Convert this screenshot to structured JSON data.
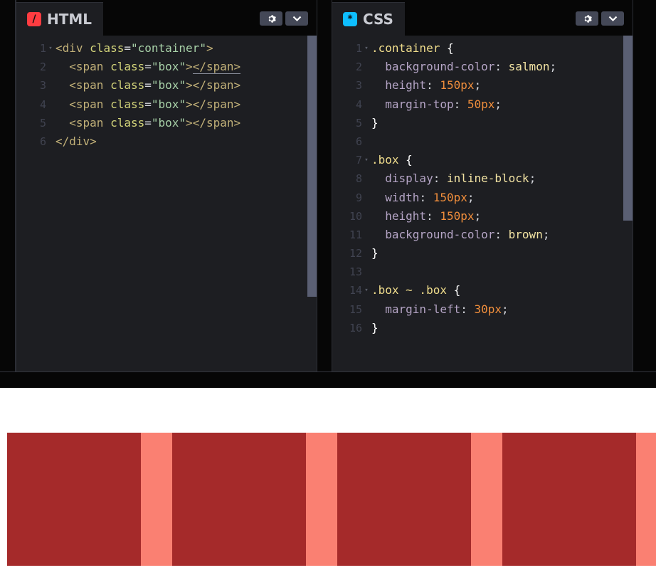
{
  "html_pane": {
    "title": "HTML",
    "icon": "html-slash-icon",
    "icon_color": "#ff3c41",
    "lines": [
      {
        "n": "1",
        "fold": true,
        "parts": [
          [
            "tag",
            "<div "
          ],
          [
            "attr",
            "class"
          ],
          [
            "punc",
            "="
          ],
          [
            "str",
            "\"container\""
          ],
          [
            "tag",
            ">"
          ]
        ]
      },
      {
        "n": "2",
        "fold": false,
        "parts": [
          [
            "punc",
            "  "
          ],
          [
            "tag",
            "<span "
          ],
          [
            "attr",
            "class"
          ],
          [
            "punc",
            "="
          ],
          [
            "str",
            "\"box\""
          ],
          [
            "tag",
            ">"
          ],
          [
            "tag-u",
            "</span>"
          ]
        ]
      },
      {
        "n": "3",
        "fold": false,
        "parts": [
          [
            "punc",
            "  "
          ],
          [
            "tag",
            "<span "
          ],
          [
            "attr",
            "class"
          ],
          [
            "punc",
            "="
          ],
          [
            "str",
            "\"box\""
          ],
          [
            "tag",
            ">"
          ],
          [
            "tag",
            "</span>"
          ]
        ]
      },
      {
        "n": "4",
        "fold": false,
        "parts": [
          [
            "punc",
            "  "
          ],
          [
            "tag",
            "<span "
          ],
          [
            "attr",
            "class"
          ],
          [
            "punc",
            "="
          ],
          [
            "str",
            "\"box\""
          ],
          [
            "tag",
            ">"
          ],
          [
            "tag",
            "</span>"
          ]
        ]
      },
      {
        "n": "5",
        "fold": false,
        "parts": [
          [
            "punc",
            "  "
          ],
          [
            "tag",
            "<span "
          ],
          [
            "attr",
            "class"
          ],
          [
            "punc",
            "="
          ],
          [
            "str",
            "\"box\""
          ],
          [
            "tag",
            ">"
          ],
          [
            "tag",
            "</span>"
          ]
        ]
      },
      {
        "n": "6",
        "fold": false,
        "parts": [
          [
            "tag",
            "</div>"
          ]
        ]
      }
    ]
  },
  "css_pane": {
    "title": "CSS",
    "icon": "css-asterisk-icon",
    "icon_color": "#0ebeff",
    "lines": [
      {
        "n": "1",
        "fold": true,
        "parts": [
          [
            "sel",
            ".container"
          ],
          [
            "brace",
            " {"
          ]
        ]
      },
      {
        "n": "2",
        "fold": false,
        "parts": [
          [
            "punc",
            "  "
          ],
          [
            "prop",
            "background-color"
          ],
          [
            "punc",
            ": "
          ],
          [
            "val",
            "salmon"
          ],
          [
            "punc",
            ";"
          ]
        ]
      },
      {
        "n": "3",
        "fold": false,
        "parts": [
          [
            "punc",
            "  "
          ],
          [
            "prop",
            "height"
          ],
          [
            "punc",
            ": "
          ],
          [
            "num",
            "150px"
          ],
          [
            "punc",
            ";"
          ]
        ]
      },
      {
        "n": "4",
        "fold": false,
        "parts": [
          [
            "punc",
            "  "
          ],
          [
            "prop",
            "margin-top"
          ],
          [
            "punc",
            ": "
          ],
          [
            "num",
            "50px"
          ],
          [
            "punc",
            ";"
          ]
        ]
      },
      {
        "n": "5",
        "fold": false,
        "parts": [
          [
            "brace",
            "}"
          ]
        ]
      },
      {
        "n": "6",
        "fold": false,
        "parts": []
      },
      {
        "n": "7",
        "fold": true,
        "parts": [
          [
            "sel",
            ".box"
          ],
          [
            "brace",
            " {"
          ]
        ]
      },
      {
        "n": "8",
        "fold": false,
        "parts": [
          [
            "punc",
            "  "
          ],
          [
            "prop",
            "display"
          ],
          [
            "punc",
            ": "
          ],
          [
            "val",
            "inline-block"
          ],
          [
            "punc",
            ";"
          ]
        ]
      },
      {
        "n": "9",
        "fold": false,
        "parts": [
          [
            "punc",
            "  "
          ],
          [
            "prop",
            "width"
          ],
          [
            "punc",
            ": "
          ],
          [
            "num",
            "150px"
          ],
          [
            "punc",
            ";"
          ]
        ]
      },
      {
        "n": "10",
        "fold": false,
        "parts": [
          [
            "punc",
            "  "
          ],
          [
            "prop",
            "height"
          ],
          [
            "punc",
            ": "
          ],
          [
            "num",
            "150px"
          ],
          [
            "punc",
            ";"
          ]
        ]
      },
      {
        "n": "11",
        "fold": false,
        "parts": [
          [
            "punc",
            "  "
          ],
          [
            "prop",
            "background-color"
          ],
          [
            "punc",
            ": "
          ],
          [
            "val",
            "brown"
          ],
          [
            "punc",
            ";"
          ]
        ]
      },
      {
        "n": "12",
        "fold": false,
        "parts": [
          [
            "brace",
            "}"
          ]
        ]
      },
      {
        "n": "13",
        "fold": false,
        "parts": []
      },
      {
        "n": "14",
        "fold": true,
        "parts": [
          [
            "sel",
            ".box ~ .box"
          ],
          [
            "brace",
            " {"
          ]
        ]
      },
      {
        "n": "15",
        "fold": false,
        "parts": [
          [
            "punc",
            "  "
          ],
          [
            "prop",
            "margin-left"
          ],
          [
            "punc",
            ": "
          ],
          [
            "num",
            "30px"
          ],
          [
            "punc",
            ";"
          ]
        ]
      },
      {
        "n": "16",
        "fold": false,
        "parts": [
          [
            "brace",
            "}"
          ]
        ]
      }
    ]
  },
  "header_buttons": [
    "gear-icon",
    "chevron-down-icon"
  ],
  "preview": {
    "container_color": "#fa8072",
    "box_color": "#a52a2a",
    "box_count": 4
  }
}
